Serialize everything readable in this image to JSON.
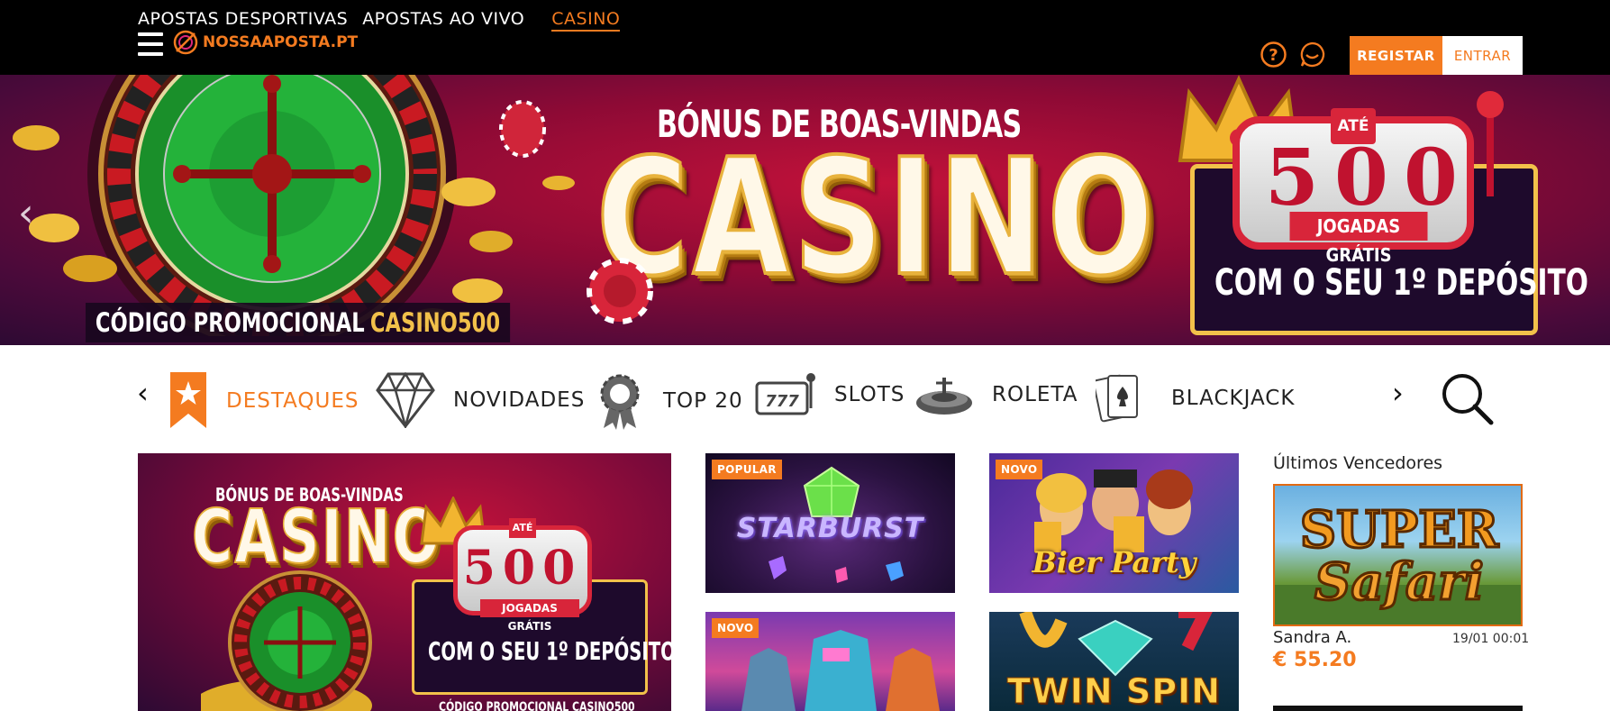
{
  "topnav": {
    "links": [
      "APOSTAS DESPORTIVAS",
      "APOSTAS AO VIVO",
      "CASINO"
    ],
    "active": "CASINO"
  },
  "brand": {
    "logo_text": "NOSSAAPOSTA.PT"
  },
  "account": {
    "register_label": "REGISTAR",
    "login_label": "ENTRAR"
  },
  "hero": {
    "subtitle": "BÓNUS DE BOAS-VINDAS",
    "title": "CASINO",
    "promo_label": "CÓDIGO PROMOCIONAL",
    "promo_code": "CASINO500",
    "upto": "ATÉ",
    "spins_digits": [
      "5",
      "0",
      "0"
    ],
    "spins_label": "JOGADAS GRÁTIS",
    "deposit_text": "COM O SEU 1º DEPÓSITO"
  },
  "categories": [
    {
      "label": "DESTAQUES",
      "icon": "star-bookmark-icon",
      "active": true
    },
    {
      "label": "NOVIDADES",
      "icon": "diamond-icon"
    },
    {
      "label": "TOP 20",
      "icon": "award-badge-icon"
    },
    {
      "label": "SLOTS",
      "icon": "slot-machine-icon"
    },
    {
      "label": "ROLETA",
      "icon": "roulette-icon"
    },
    {
      "label": "BLACKJACK",
      "icon": "playing-cards-icon"
    }
  ],
  "promo_tile": {
    "subtitle": "BÓNUS DE BOAS-VINDAS",
    "title": "CASINO",
    "upto": "ATÉ",
    "spins": "500",
    "spins_label": "JOGADAS GRÁTIS",
    "deposit_text": "COM O SEU 1º DEPÓSITO",
    "promo_text": "CÓDIGO PROMOCIONAL CASINO500"
  },
  "games": [
    {
      "title": "STARBURST",
      "badge": "POPULAR"
    },
    {
      "title": "Bier Party",
      "badge": "NOVO"
    },
    {
      "title": "",
      "badge": "NOVO"
    },
    {
      "title": "TWIN SPIN",
      "badge": ""
    }
  ],
  "winners": {
    "heading": "Últimos Vencedores",
    "items": [
      {
        "game": "Super Safari",
        "name": "Sandra A.",
        "time": "19/01 00:01",
        "amount": "€ 55.20"
      }
    ]
  },
  "colors": {
    "accent": "#f47b20",
    "topbar": "#000000",
    "hero": "#8e0a35"
  }
}
